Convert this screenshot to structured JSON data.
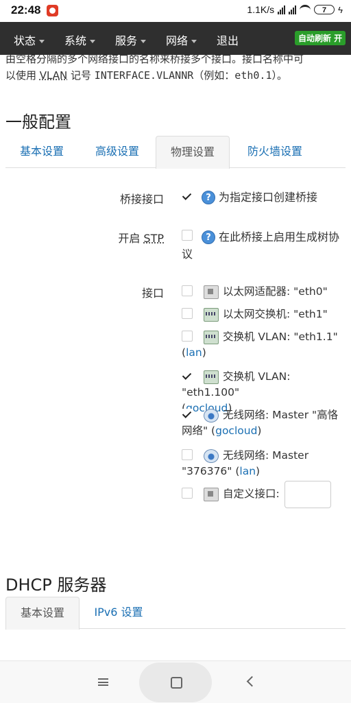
{
  "status_bar": {
    "time": "22:48",
    "network_speed": "1.1K/s",
    "battery": "7"
  },
  "navbar": {
    "items": [
      {
        "label": "状态"
      },
      {
        "label": "系统"
      },
      {
        "label": "服务"
      },
      {
        "label": "网络"
      },
      {
        "label": "退出"
      }
    ],
    "auto_refresh": "自动刷新 开"
  },
  "description": {
    "line1": "由空格分隔的多个网络接口的名称来桥接多个接口。接口名称中可",
    "line2_prefix": "以使用 ",
    "line2_vlan": "VLAN",
    "line2_mid": " 记号 ",
    "line2_code": "INTERFACE.VLANNR",
    "line2_suffix": "（例如：",
    "line2_example": "eth0.1",
    "line2_end": "）。"
  },
  "general_config": {
    "title": "一般配置",
    "tabs": [
      {
        "label": "基本设置",
        "active": false
      },
      {
        "label": "高级设置",
        "active": false
      },
      {
        "label": "物理设置",
        "active": true
      },
      {
        "label": "防火墙设置",
        "active": false
      }
    ]
  },
  "bridge": {
    "label": "桥接接口",
    "checked": true,
    "text": "为指定接口创建桥接"
  },
  "stp": {
    "label_prefix": "开启 ",
    "label_abbr": "STP",
    "checked": false,
    "text_line1": "在此桥接上启用生成树协",
    "text_line2": "议"
  },
  "interfaces": {
    "label": "接口",
    "items": [
      {
        "checked": false,
        "icon": "ethernet-adapter-icon",
        "line1": "以太网适配器: \"eth0\"",
        "line2": "",
        "tag": "",
        "tag_suffix": ""
      },
      {
        "checked": false,
        "icon": "ethernet-switch-icon",
        "line1": "以太网交换机: \"eth1\"",
        "line2": "",
        "tag": "",
        "tag_suffix": ""
      },
      {
        "checked": false,
        "icon": "switch-vlan-icon",
        "line1": "交换机 VLAN: \"eth1.1\"",
        "line2": "(",
        "tag": "lan",
        "tag_suffix": ")"
      },
      {
        "checked": true,
        "icon": "switch-vlan-icon",
        "line1": "交换机 VLAN: \"eth1.100\"",
        "line2": "(",
        "tag": "gocloud",
        "tag_suffix": ")"
      },
      {
        "checked": true,
        "icon": "wireless-icon",
        "line1": "无线网络: Master \"高恪",
        "line2": "网络\" (",
        "tag": "gocloud",
        "tag_suffix": ")"
      },
      {
        "checked": false,
        "icon": "wireless-icon",
        "line1": "无线网络: Master",
        "line2": "\"376376\" (",
        "tag": "lan",
        "tag_suffix": ")"
      }
    ],
    "custom": {
      "checked": false,
      "label": "自定义接口:",
      "value": ""
    }
  },
  "dhcp": {
    "title": "DHCP 服务器",
    "tabs": [
      {
        "label": "基本设置",
        "active": true
      },
      {
        "label": "IPv6 设置",
        "active": false
      }
    ]
  }
}
